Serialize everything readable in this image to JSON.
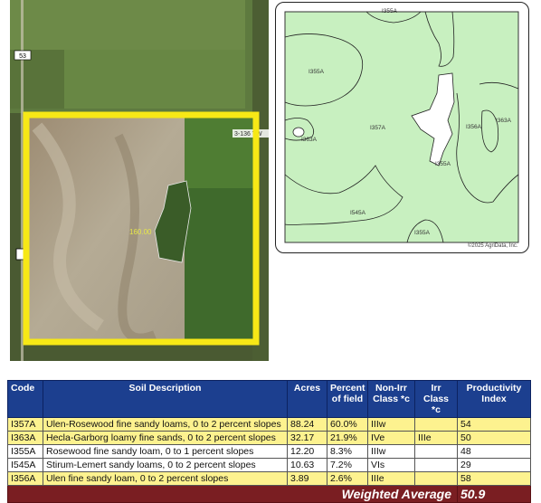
{
  "aerial": {
    "road_marker": "53",
    "road_label": "3-136 TW",
    "field_acres_label": "160.00"
  },
  "soil_map": {
    "labels": [
      "I355A",
      "I355A",
      "I357A",
      "I363A",
      "I356A",
      "I363A",
      "I355A",
      "I545A",
      "I355A"
    ],
    "copyright": "©2025 AgriData, Inc."
  },
  "table": {
    "headers": {
      "code": "Code",
      "description": "Soil Description",
      "acres": "Acres",
      "percent": "Percent of field",
      "nonirr": "Non-Irr Class *c",
      "irr": "Irr Class *c",
      "productivity": "Productivity Index"
    },
    "rows": [
      {
        "code": "I357A",
        "description": "Ulen-Rosewood fine sandy loams, 0 to 2 percent slopes",
        "acres": "88.24",
        "percent": "60.0%",
        "nonirr": "IIIw",
        "irr": "",
        "productivity": "54"
      },
      {
        "code": "I363A",
        "description": "Hecla-Garborg loamy fine sands, 0 to 2 percent slopes",
        "acres": "32.17",
        "percent": "21.9%",
        "nonirr": "IVe",
        "irr": "IIIe",
        "productivity": "50"
      },
      {
        "code": "I355A",
        "description": "Rosewood fine sandy loam, 0 to 1 percent slopes",
        "acres": "12.20",
        "percent": "8.3%",
        "nonirr": "IIIw",
        "irr": "",
        "productivity": "48"
      },
      {
        "code": "I545A",
        "description": "Stirum-Lemert sandy loams, 0 to 2 percent slopes",
        "acres": "10.63",
        "percent": "7.2%",
        "nonirr": "VIs",
        "irr": "",
        "productivity": "29"
      },
      {
        "code": "I356A",
        "description": "Ulen fine sandy loam, 0 to 2 percent slopes",
        "acres": "3.89",
        "percent": "2.6%",
        "nonirr": "IIIe",
        "irr": "",
        "productivity": "58"
      }
    ],
    "weighted_average_label": "Weighted Average",
    "weighted_average_value": "50.9"
  },
  "colors": {
    "header_blue": "#1c3f8f",
    "row_yellow": "#fdf28f",
    "footer_maroon": "#7a1e22",
    "boundary_yellow": "#f7e816",
    "soil_green": "#c8f0c0"
  }
}
